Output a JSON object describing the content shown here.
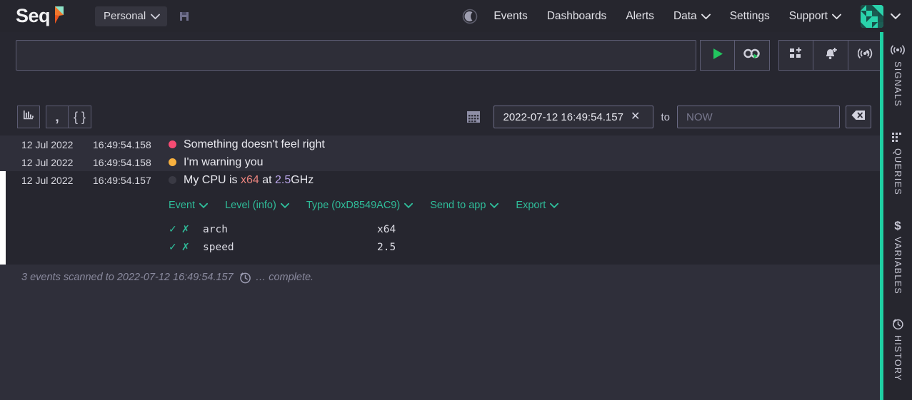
{
  "brand": {
    "name": "Seq",
    "logo_icon": "seq-flag-logo"
  },
  "topnav": {
    "workspace": {
      "label": "Personal",
      "chevron_icon": "chevron-down-icon"
    },
    "save_icon": "save-icon",
    "theme_toggle_icon": "moon-icon",
    "links": [
      {
        "label": "Events",
        "has_chevron": false,
        "name": "events"
      },
      {
        "label": "Dashboards",
        "has_chevron": false,
        "name": "dashboards"
      },
      {
        "label": "Alerts",
        "has_chevron": false,
        "name": "alerts"
      },
      {
        "label": "Data",
        "has_chevron": true,
        "name": "data"
      },
      {
        "label": "Settings",
        "has_chevron": false,
        "name": "settings"
      },
      {
        "label": "Support",
        "has_chevron": true,
        "name": "support"
      }
    ],
    "avatar_icon": "user-avatar-identicon",
    "avatar_chevron_icon": "chevron-down-icon"
  },
  "query": {
    "value": "",
    "placeholder": "",
    "ellipsis": "…",
    "buttons": [
      {
        "name": "run-query-button",
        "icon": "play-icon",
        "tooltip": "Run"
      },
      {
        "name": "loop-query-button",
        "icon": "infinity-play-icon",
        "tooltip": "Tail"
      },
      {
        "name": "add-to-dashboard-button",
        "icon": "dashboard-plus-icon",
        "tooltip": "Add to dashboard"
      },
      {
        "name": "create-alert-button",
        "icon": "bell-plus-icon",
        "tooltip": "Create alert"
      },
      {
        "name": "create-signal-button",
        "icon": "signal-plus-icon",
        "tooltip": "Create signal"
      }
    ]
  },
  "toolbar": {
    "view_buttons": [
      {
        "name": "chart-view-button",
        "icon": "bar-chart-icon"
      },
      {
        "name": "raw-text-view-button",
        "icon": "quote-icon"
      },
      {
        "name": "json-view-button",
        "icon": "braces-icon"
      }
    ],
    "calendar_icon": "calendar-icon",
    "from_value": "2022-07-12 16:49:54.157",
    "from_clear_icon": "close-icon",
    "to_label": "to",
    "to_value": "",
    "to_placeholder": "NOW",
    "clear_range_icon": "backspace-icon"
  },
  "events": [
    {
      "date": "12 Jul 2022",
      "time": "16:49:54.158",
      "level_color": "#f64b73",
      "level": "error",
      "message_parts": [
        {
          "text": "Something doesn't feel right",
          "style": "plain"
        }
      ],
      "expanded": false
    },
    {
      "date": "12 Jul 2022",
      "time": "16:49:54.158",
      "level_color": "#f7b03f",
      "level": "warning",
      "message_parts": [
        {
          "text": "I'm warning you",
          "style": "plain"
        }
      ],
      "expanded": false
    },
    {
      "date": "12 Jul 2022",
      "time": "16:49:54.157",
      "level_color": "#3a3a44",
      "level": "info",
      "message_parts": [
        {
          "text": "My CPU is ",
          "style": "plain"
        },
        {
          "text": "x64",
          "style": "token-a"
        },
        {
          "text": " at ",
          "style": "plain"
        },
        {
          "text": "2.5",
          "style": "token-b"
        },
        {
          "text": "GHz",
          "style": "plain"
        }
      ],
      "expanded": true
    }
  ],
  "detail": {
    "actions": [
      {
        "label": "Event",
        "name": "event-menu",
        "chevron_icon": "chevron-down-icon"
      },
      {
        "label": "Level (info)",
        "name": "level-menu",
        "chevron_icon": "chevron-down-icon"
      },
      {
        "label": "Type (0xD8549AC9)",
        "name": "type-menu",
        "chevron_icon": "chevron-down-icon"
      },
      {
        "label": "Send to app",
        "name": "send-to-app-menu",
        "chevron_icon": "chevron-down-icon"
      },
      {
        "label": "Export",
        "name": "export-menu",
        "chevron_icon": "chevron-down-icon"
      }
    ],
    "include_icon": "check-icon",
    "exclude_icon": "x-icon",
    "properties": [
      {
        "name": "arch",
        "value": "x64"
      },
      {
        "name": "speed",
        "value": "2.5"
      }
    ]
  },
  "status": {
    "text_before": "3 events scanned to 2022-07-12 16:49:54.157",
    "clock_icon": "history-clock-icon",
    "text_after": "… complete."
  },
  "rail": {
    "accent_color": "#1fd0a3",
    "items": [
      {
        "label": "SIGNALS",
        "icon": "signal-icon",
        "name": "signals"
      },
      {
        "label": "QUERIES",
        "icon": "queries-grid-icon",
        "name": "queries"
      },
      {
        "label": "VARIABLES",
        "icon": "dollar-icon",
        "name": "variables"
      },
      {
        "label": "HISTORY",
        "icon": "history-clock-icon",
        "name": "history"
      }
    ]
  }
}
